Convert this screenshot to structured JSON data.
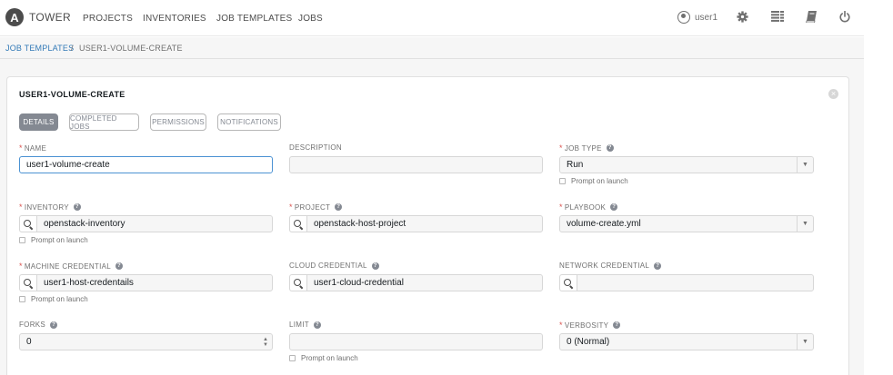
{
  "nav": {
    "logo_letter": "A",
    "logo_text": "TOWER",
    "links": [
      "PROJECTS",
      "INVENTORIES",
      "JOB TEMPLATES",
      "JOBS"
    ],
    "user": "user1",
    "icons": [
      "user-icon",
      "gear-icon",
      "list-icon",
      "book-icon",
      "power-icon"
    ]
  },
  "breadcrumb": {
    "parent": "JOB TEMPLATES",
    "separator": "/",
    "current": "USER1-VOLUME-CREATE"
  },
  "panel": {
    "title": "USER1-VOLUME-CREATE",
    "close": "×",
    "tabs": [
      "DETAILS",
      "COMPLETED JOBS",
      "PERMISSIONS",
      "NOTIFICATIONS"
    ],
    "active_tab": "DETAILS"
  },
  "form": {
    "required_mark": "*",
    "help_glyph": "?",
    "prompt_label": "Prompt on launch",
    "name": {
      "label": "NAME",
      "value": "user1-volume-create"
    },
    "description": {
      "label": "DESCRIPTION",
      "value": ""
    },
    "job_type": {
      "label": "JOB TYPE",
      "value": "Run"
    },
    "inventory": {
      "label": "INVENTORY",
      "value": "openstack-inventory"
    },
    "project": {
      "label": "PROJECT",
      "value": "openstack-host-project"
    },
    "playbook": {
      "label": "PLAYBOOK",
      "value": "volume-create.yml"
    },
    "machine_credential": {
      "label": "MACHINE CREDENTIAL",
      "value": "user1-host-credentails"
    },
    "cloud_credential": {
      "label": "CLOUD CREDENTIAL",
      "value": "user1-cloud-credential"
    },
    "network_credential": {
      "label": "NETWORK CREDENTIAL",
      "value": ""
    },
    "forks": {
      "label": "FORKS",
      "value": "0"
    },
    "limit": {
      "label": "LIMIT",
      "value": ""
    },
    "verbosity": {
      "label": "VERBOSITY",
      "value": "0 (Normal)"
    }
  },
  "colors": {
    "accent_blue": "#337ab7",
    "focus_border": "#4b92d3",
    "required_red": "#d9534f",
    "active_tab_bg": "#848992"
  }
}
